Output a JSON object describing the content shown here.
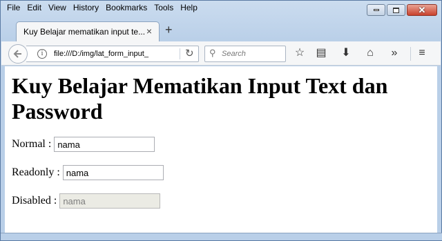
{
  "menu": [
    "File",
    "Edit",
    "View",
    "History",
    "Bookmarks",
    "Tools",
    "Help"
  ],
  "tab": {
    "title": "Kuy Belajar mematikan input te...",
    "close": "×",
    "new_tab": "+"
  },
  "navbar": {
    "url": "file:///D:/img/lat_form_input_",
    "search_placeholder": "Search"
  },
  "page": {
    "title": "Kuy Belajar Mematikan Input Text dan Password",
    "normal_label": "Normal :",
    "normal_value": "nama",
    "readonly_label": "Readonly :",
    "readonly_value": "nama",
    "disabled_label": "Disabled :",
    "disabled_value": "nama"
  },
  "icons": [
    "back-icon",
    "info-icon",
    "reload-icon",
    "search-icon",
    "star-icon",
    "reading-list-icon",
    "download-icon",
    "home-icon",
    "overflow-icon",
    "menu-icon"
  ]
}
